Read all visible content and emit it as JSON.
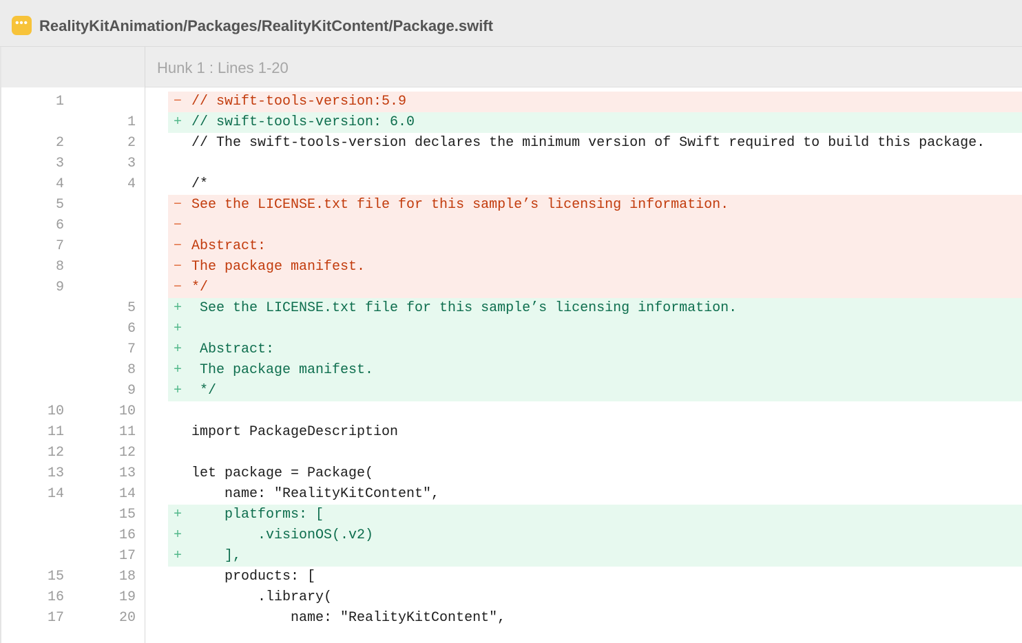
{
  "header": {
    "file_icon": "ellipsis-icon",
    "file_icon_glyph": "•••",
    "file_path": "RealityKitAnimation/Packages/RealityKitContent/Package.swift"
  },
  "hunk": {
    "label": "Hunk 1 : Lines 1-20"
  },
  "colors": {
    "deleted_bg": "#fdece8",
    "deleted_text": "#c23b0c",
    "added_bg": "#e7f9ef",
    "added_text": "#0e6e4e",
    "file_icon": "#f7c33a"
  },
  "lines": [
    {
      "type": "del",
      "old": "1",
      "new": "",
      "sign": "−",
      "code": "// swift-tools-version:5.9"
    },
    {
      "type": "add",
      "old": "",
      "new": "1",
      "sign": "+",
      "code": "// swift-tools-version: 6.0"
    },
    {
      "type": "ctx",
      "old": "2",
      "new": "2",
      "sign": "",
      "code": "// The swift-tools-version declares the minimum version of Swift required to build this package."
    },
    {
      "type": "ctx",
      "old": "3",
      "new": "3",
      "sign": "",
      "code": ""
    },
    {
      "type": "ctx",
      "old": "4",
      "new": "4",
      "sign": "",
      "code": "/*"
    },
    {
      "type": "del",
      "old": "5",
      "new": "",
      "sign": "−",
      "code": "See the LICENSE.txt file for this sample’s licensing information."
    },
    {
      "type": "del",
      "old": "6",
      "new": "",
      "sign": "−",
      "code": ""
    },
    {
      "type": "del",
      "old": "7",
      "new": "",
      "sign": "−",
      "code": "Abstract:"
    },
    {
      "type": "del",
      "old": "8",
      "new": "",
      "sign": "−",
      "code": "The package manifest."
    },
    {
      "type": "del",
      "old": "9",
      "new": "",
      "sign": "−",
      "code": "*/"
    },
    {
      "type": "add",
      "old": "",
      "new": "5",
      "sign": "+",
      "code": " See the LICENSE.txt file for this sample’s licensing information."
    },
    {
      "type": "add",
      "old": "",
      "new": "6",
      "sign": "+",
      "code": ""
    },
    {
      "type": "add",
      "old": "",
      "new": "7",
      "sign": "+",
      "code": " Abstract:"
    },
    {
      "type": "add",
      "old": "",
      "new": "8",
      "sign": "+",
      "code": " The package manifest."
    },
    {
      "type": "add",
      "old": "",
      "new": "9",
      "sign": "+",
      "code": " */"
    },
    {
      "type": "ctx",
      "old": "10",
      "new": "10",
      "sign": "",
      "code": ""
    },
    {
      "type": "ctx",
      "old": "11",
      "new": "11",
      "sign": "",
      "code": "import PackageDescription"
    },
    {
      "type": "ctx",
      "old": "12",
      "new": "12",
      "sign": "",
      "code": ""
    },
    {
      "type": "ctx",
      "old": "13",
      "new": "13",
      "sign": "",
      "code": "let package = Package("
    },
    {
      "type": "ctx",
      "old": "14",
      "new": "14",
      "sign": "",
      "code": "    name: \"RealityKitContent\","
    },
    {
      "type": "add",
      "old": "",
      "new": "15",
      "sign": "+",
      "code": "    platforms: ["
    },
    {
      "type": "add",
      "old": "",
      "new": "16",
      "sign": "+",
      "code": "        .visionOS(.v2)"
    },
    {
      "type": "add",
      "old": "",
      "new": "17",
      "sign": "+",
      "code": "    ],"
    },
    {
      "type": "ctx",
      "old": "15",
      "new": "18",
      "sign": "",
      "code": "    products: ["
    },
    {
      "type": "ctx",
      "old": "16",
      "new": "19",
      "sign": "",
      "code": "        .library("
    },
    {
      "type": "ctx",
      "old": "17",
      "new": "20",
      "sign": "",
      "code": "            name: \"RealityKitContent\","
    }
  ]
}
